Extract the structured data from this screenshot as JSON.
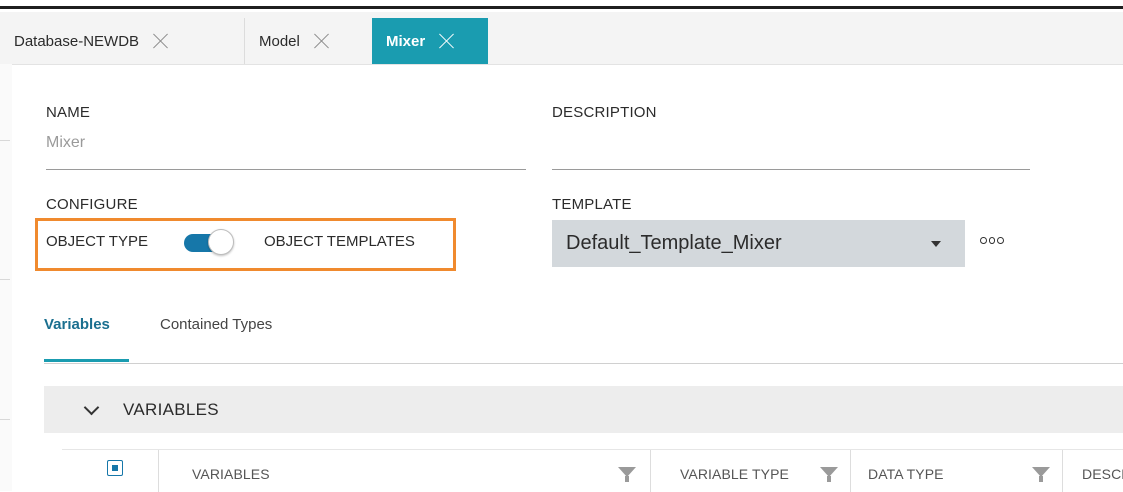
{
  "tabs": [
    {
      "label": "Database-NEWDB",
      "active": false
    },
    {
      "label": "Model",
      "active": false
    },
    {
      "label": "Mixer",
      "active": true
    }
  ],
  "form": {
    "name_label": "NAME",
    "name_value": "Mixer",
    "description_label": "DESCRIPTION",
    "description_value": "",
    "configure_label": "CONFIGURE",
    "toggle_left_label": "OBJECT TYPE",
    "toggle_right_label": "OBJECT TEMPLATES",
    "toggle_on": true,
    "template_label": "TEMPLATE",
    "template_value": "Default_Template_Mixer"
  },
  "subtabs": [
    {
      "label": "Variables",
      "active": true
    },
    {
      "label": "Contained Types",
      "active": false
    }
  ],
  "section": {
    "title": "VARIABLES",
    "expanded": true
  },
  "table": {
    "columns": [
      "VARIABLES",
      "VARIABLE TYPE",
      "DATA TYPE",
      "DESCR"
    ]
  },
  "icons": {
    "tab_close": "close-icon",
    "dropdown": "caret-down-icon",
    "more": "more-options-icon",
    "section_toggle": "chevron-down-icon",
    "filter": "filter-icon",
    "select_all": "checkbox-icon"
  },
  "colors": {
    "active_tab": "#1a9cb0",
    "toggle_track": "#1677a9",
    "highlight_box": "#f08a2e",
    "select_bg": "#d3d8dc"
  }
}
